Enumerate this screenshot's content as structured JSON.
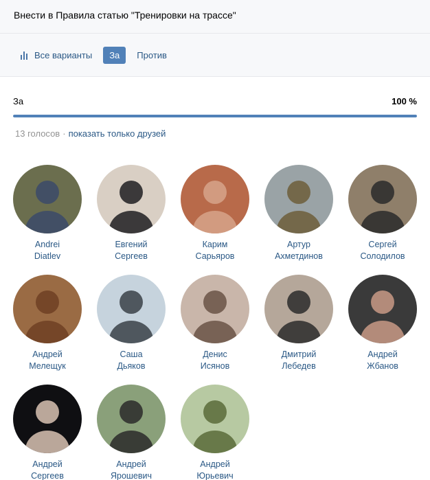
{
  "header": {
    "title": "Внести в Правила статью \"Тренировки на трассе\""
  },
  "tabs": [
    {
      "label": "Все варианты",
      "icon": "bar-chart-icon",
      "active": false
    },
    {
      "label": "За",
      "active": true
    },
    {
      "label": "Против",
      "active": false
    }
  ],
  "result": {
    "option": "За",
    "percent": "100 %",
    "fraction": 1.0
  },
  "meta": {
    "votes": "13 голосов",
    "separator": "·",
    "friends_link": "показать только друзей"
  },
  "voters": [
    {
      "first": "Andrei",
      "last": "Diatlev",
      "bg": "#6b6e4e",
      "fg": "#3b4a6a"
    },
    {
      "first": "Евгений",
      "last": "Сергеев",
      "bg": "#d9cfc4",
      "fg": "#1f1f22"
    },
    {
      "first": "Карим",
      "last": "Сарьяров",
      "bg": "#b86a4a",
      "fg": "#d6a38a"
    },
    {
      "first": "Артур",
      "last": "Ахметдинов",
      "bg": "#9aa3a6",
      "fg": "#6d5e3a"
    },
    {
      "first": "Сергей",
      "last": "Солодилов",
      "bg": "#8f7f6a",
      "fg": "#2a2a2a"
    },
    {
      "first": "Андрей",
      "last": "Мелещук",
      "bg": "#9a6b44",
      "fg": "#6e3f23"
    },
    {
      "first": "Саша",
      "last": "Дьяков",
      "bg": "#c6d3dd",
      "fg": "#3a4148"
    },
    {
      "first": "Денис",
      "last": "Исянов",
      "bg": "#c9b6aa",
      "fg": "#6a5446"
    },
    {
      "first": "Дмитрий",
      "last": "Лебедев",
      "bg": "#b5a79a",
      "fg": "#2b2b2b"
    },
    {
      "first": "Андрей",
      "last": "Жбанов",
      "bg": "#3a3a3a",
      "fg": "#c99a86"
    },
    {
      "first": "Андрей",
      "last": "Сергеев",
      "bg": "#0f0f12",
      "fg": "#d8c2b3"
    },
    {
      "first": "Андрей",
      "last": "Ярошевич",
      "bg": "#8aa07a",
      "fg": "#2a2a2a"
    },
    {
      "first": "Андрей",
      "last": "Юрьевич",
      "bg": "#b7c9a2",
      "fg": "#5a6b3a"
    }
  ]
}
